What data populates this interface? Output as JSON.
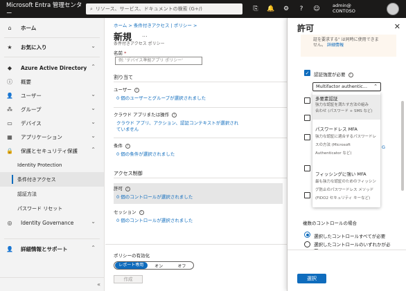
{
  "topbar": {
    "brand": "Microsoft Entra 管理センター",
    "search_placeholder": "リソース、サービス、ドキュメントの検索 (G+/)",
    "account_line1": "admin@",
    "account_line2": "CONTOSO"
  },
  "sidebar": {
    "home": "ホーム",
    "favorites": "お気に入り",
    "aad": "Azure Active Directory",
    "items": [
      "概要",
      "ユーザー",
      "グループ",
      "デバイス",
      "アプリケーション",
      "保護とセキュリティ保護"
    ],
    "sub": [
      "Identity Protection",
      "条件付きアクセス",
      "認証方法",
      "パスワード リセット"
    ],
    "identity_governance": "Identity Governance",
    "learn_support": "詳細情報とサポート",
    "collapse": "«"
  },
  "main": {
    "breadcrumb": "ホーム > 条件付きアクセス | ポリシー >",
    "title": "新規",
    "more": "...",
    "subtitle": "条件付きアクセス ポリシー",
    "name_label": "名前",
    "name_required": "*",
    "name_placeholder": "例: 'デバイス準拠アプリ ポリシー'",
    "assignments": "割り当て",
    "users_label": "ユーザー",
    "users_link": "0 個のユーザーとグループが選択されました",
    "cloud_label": "クラウド アプリまたは操作",
    "cloud_link": "クラウド アプリ、アクション、認証コンテキストが選択されていません",
    "conditions_label": "条件",
    "conditions_link": "0 個の条件が選択されました",
    "access_controls": "アクセス制御",
    "grant_label": "許可",
    "grant_link": "0 個のコントロールが選択されました",
    "session_label": "セッション",
    "session_link": "0 個のコントロールが選択されました",
    "enable_label": "ポリシーの有効化",
    "toggle": [
      "レポート専用",
      "オン",
      "オフ"
    ],
    "create": "作成"
  },
  "panel": {
    "title": "許可",
    "close": "✕",
    "info_line1": "証を要求する\" は同時に使用できま",
    "info_line2": "せん。",
    "info_link": "詳細情報",
    "require_auth_strength": "認証強度が必要",
    "dropdown_value": "Multifactor authentic...",
    "options": [
      {
        "head": "多要素認証",
        "desc1": "強力な認証を満たす方法の組み",
        "desc2": "合わせ (パスワード + SMS など)"
      },
      {
        "head": "パスワードレス MFA",
        "desc1": "強力な認証に適合するパスワードレ",
        "desc2": "スの方法 (Microsoft",
        "desc3": "Authenticator など)"
      },
      {
        "head": "フィッシングに強い MFA",
        "desc1": "最も強力な認証のためのフィッシン",
        "desc2": "グ防止のパスワードレス メソッド",
        "desc3": "(FIDO2 セキュリティ キーなど)"
      }
    ],
    "edge_letter": "G",
    "multi_label": "複数のコントロールの場合",
    "radio1": "選択したコントロールすべてが必要",
    "radio2_line1": "選択したコントロールのいずれかが必",
    "radio2_line2": "要",
    "select_button": "選択"
  }
}
